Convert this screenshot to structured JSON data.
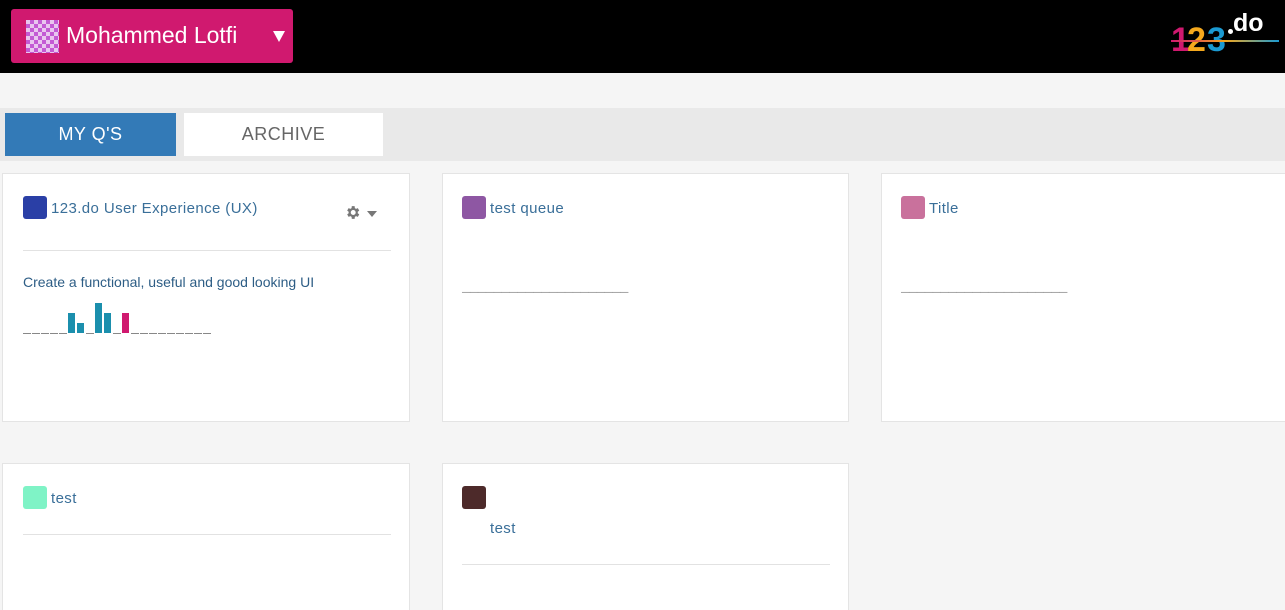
{
  "header": {
    "user_name": "Mohammed Lotfi",
    "user_button_color": "#d0196f",
    "logo": {
      "digit1": "1",
      "digit2": "2",
      "digit3": "3",
      "suffix": "do"
    }
  },
  "tabs": [
    {
      "label": "MY Q'S",
      "active": true
    },
    {
      "label": "ARCHIVE",
      "active": false
    }
  ],
  "queues": [
    {
      "title": "123.do User Experience (UX)",
      "color": "#2a3fa6",
      "description": "Create a functional, useful and good looking UI",
      "sparkline": {
        "values": [
          0,
          0,
          0,
          0,
          0,
          2,
          1,
          0,
          3,
          2,
          0,
          2,
          0,
          0,
          0,
          0,
          0,
          0,
          0,
          0,
          0
        ],
        "colors": [
          "",
          "",
          "",
          "",
          "",
          "#1b8fad",
          "#1b8fad",
          "",
          "#1b8fad",
          "#1b8fad",
          "",
          "#d0196f",
          "",
          "",
          "",
          "",
          "",
          "",
          "",
          "",
          ""
        ]
      },
      "has_settings": true
    },
    {
      "title": "test queue",
      "color": "#8e57a3",
      "dashes": "_____________________"
    },
    {
      "title": "Title",
      "color": "#c9719c",
      "dashes": "_____________________"
    },
    {
      "title": "test",
      "color": "#7ff3c6"
    },
    {
      "title": "test",
      "color": "#4d2a2a"
    }
  ]
}
